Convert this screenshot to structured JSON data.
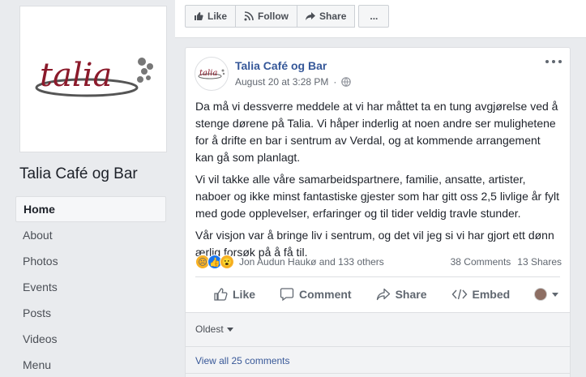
{
  "sidebar": {
    "page_name": "Talia Café og Bar",
    "logo_text": "talia",
    "nav": [
      {
        "label": "Home"
      },
      {
        "label": "About"
      },
      {
        "label": "Photos"
      },
      {
        "label": "Events"
      },
      {
        "label": "Posts"
      },
      {
        "label": "Videos"
      },
      {
        "label": "Menu"
      }
    ]
  },
  "action_bar": {
    "like": "Like",
    "follow": "Follow",
    "share": "Share",
    "more": "..."
  },
  "post": {
    "author": "Talia Café og Bar",
    "timestamp": "August 20 at 3:28 PM",
    "privacy_icon": "globe-icon",
    "paragraphs": [
      "Da må vi dessverre meddele at vi har måttet ta en tung avgjørelse ved å stenge dørene på Talia. Vi håper inderlig at noen andre ser mulighetene for å drifte en bar i sentrum av Verdal, og at kommende arrangement kan gå som planlagt.",
      "Vi vil takke alle våre samarbeidspartnere, familie, ansatte, artister, naboer og ikke minst fantastiske gjester som har gitt oss 2,5 livlige år fylt med gode opplevelser, erfaringer og til tider veldig travle stunder.",
      "Vår visjon var å bringe liv i sentrum, og det vil jeg si vi har gjort ett dønn ærlig forsøk på å få til."
    ],
    "reactions_text": "Jon Audun Haukø and 133 others",
    "comments_count": "38 Comments",
    "shares_count": "13 Shares",
    "actions": {
      "like": "Like",
      "comment": "Comment",
      "share": "Share",
      "embed": "Embed"
    },
    "sort_label": "Oldest",
    "view_all_comments": "View all 25 comments"
  },
  "colors": {
    "link_blue": "#365899",
    "background": "#e9ebee",
    "logo_red": "#8b1a2b"
  }
}
